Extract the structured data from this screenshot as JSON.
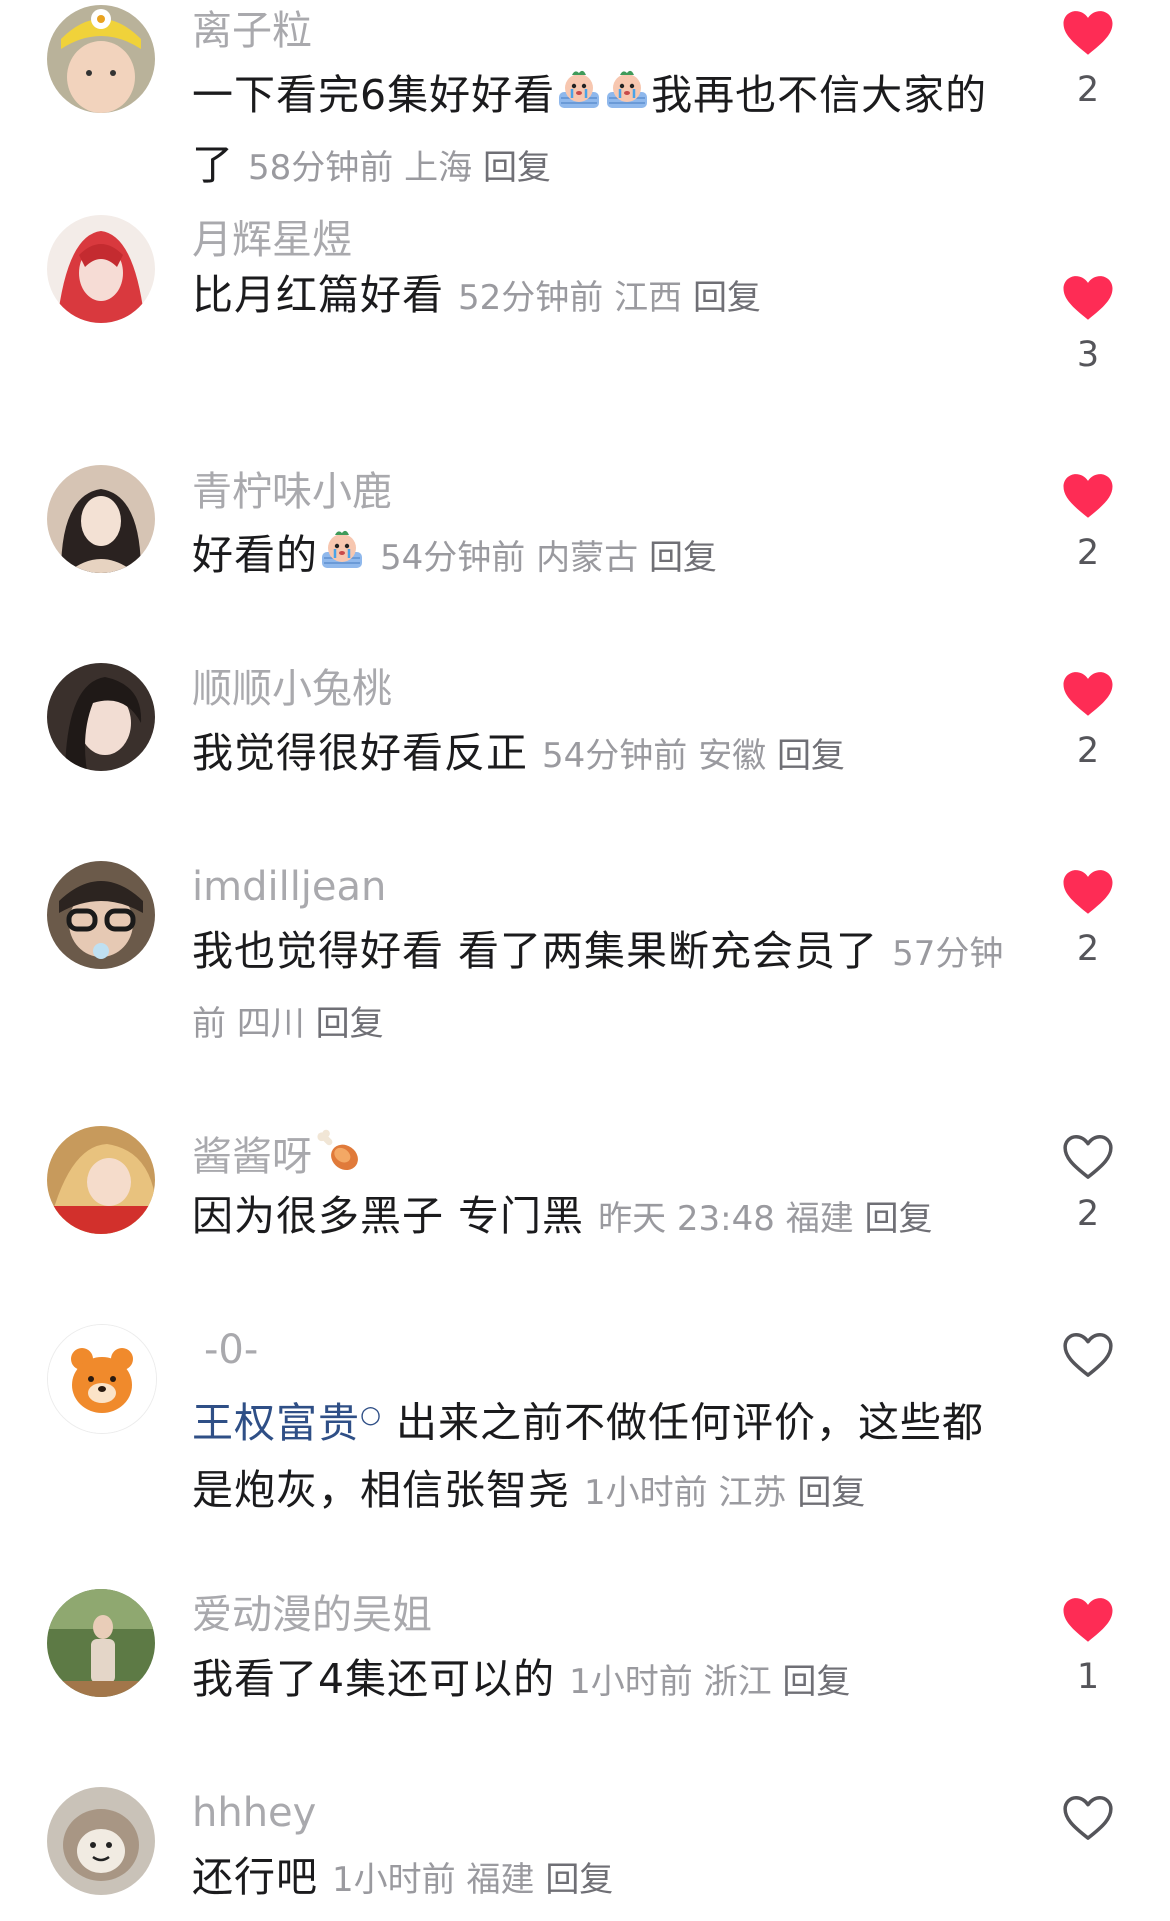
{
  "colors": {
    "liked_heart": "#fe2c55",
    "unliked_heart_stroke": "#55555a",
    "username": "#a9a9ad",
    "body_text": "#1b1b1d",
    "meta_text": "#9a9a9f",
    "mention": "#2f4f86"
  },
  "comments": [
    {
      "username": "离子粒",
      "text": "一下看完6集好好看",
      "emojis": [
        "crying-face-emoji",
        "crying-face-emoji"
      ],
      "text_after_emoji": "我再也不信大家的了",
      "time": "58分钟前",
      "location": "上海",
      "reply": "回复",
      "liked": true,
      "likes": "2"
    },
    {
      "username": "月辉星煜",
      "text": "比月红篇好看",
      "time": "52分钟前",
      "location": "江西",
      "reply": "回复",
      "liked": true,
      "likes": "3"
    },
    {
      "username": "青柠味小鹿",
      "text": "好看的",
      "emojis": [
        "crying-face-emoji"
      ],
      "time": "54分钟前",
      "location": "内蒙古",
      "reply": "回复",
      "liked": true,
      "likes": "2"
    },
    {
      "username": "顺顺小兔桃",
      "text": "我觉得很好看反正",
      "time": "54分钟前",
      "location": "安徽",
      "reply": "回复",
      "liked": true,
      "likes": "2"
    },
    {
      "username": "imdilljean",
      "text": "我也觉得好看 看了两集果断充会员了",
      "time": "57分钟前",
      "location": "四川",
      "reply": "回复",
      "liked": true,
      "likes": "2"
    },
    {
      "username": "酱酱呀",
      "username_emoji": "meat-leg-emoji",
      "text": "因为很多黑子 专门黑",
      "time": "昨天 23:48",
      "location": "福建",
      "reply": "回复",
      "liked": false,
      "likes": "2"
    },
    {
      "username": "-0-",
      "mention": "王权富贵",
      "text": "出来之前不做任何评价，这些都是炮灰，相信张智尧",
      "time": "1小时前",
      "location": "江苏",
      "reply": "回复",
      "liked": false,
      "likes": ""
    },
    {
      "username": "爱动漫的吴姐",
      "text": "我看了4集还可以的",
      "time": "1小时前",
      "location": "浙江",
      "reply": "回复",
      "liked": true,
      "likes": "1"
    },
    {
      "username": "hhhey",
      "text": "还行吧",
      "time": "1小时前",
      "location": "福建",
      "reply": "回复",
      "liked": false,
      "likes": ""
    }
  ]
}
